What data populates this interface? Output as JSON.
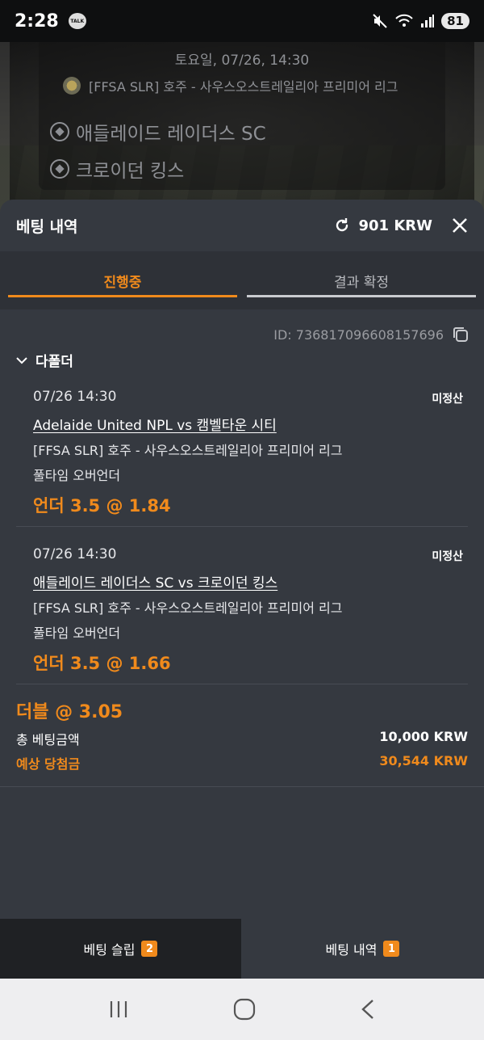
{
  "status_bar": {
    "time": "2:28",
    "talk_label": "TALK",
    "battery": "81"
  },
  "match_header": {
    "date": "토요일, 07/26, 14:30",
    "league": "[FFSA SLR] 호주 - 사우스오스트레일리아 프리미어 리그",
    "team_home": "애들레이드 레이더스 SC",
    "team_away": "크로이던 킹스"
  },
  "sheet": {
    "title": "베팅 내역",
    "balance": "901 KRW",
    "tabs": [
      {
        "label": "진행중",
        "active": true
      },
      {
        "label": "결과 확정",
        "active": false
      }
    ],
    "bet_id": "ID: 736817096608157696",
    "folder_type": "다폴더",
    "bets": [
      {
        "datetime": "07/26 14:30",
        "status": "미정산",
        "match": "Adelaide United NPL vs 캠벨타운 시티",
        "league": "[FFSA SLR] 호주 - 사우스오스트레일리아 프리미어 리그",
        "market": "풀타임 오버언더",
        "pick": "언더 3.5 @ 1.84"
      },
      {
        "datetime": "07/26 14:30",
        "status": "미정산",
        "match": "애들레이드 레이더스 SC vs 크로이던 킹스",
        "league": "[FFSA SLR] 호주 - 사우스오스트레일리아 프리미어 리그",
        "market": "풀타임 오버언더",
        "pick": "언더 3.5 @ 1.66"
      }
    ],
    "summary": {
      "type": "더블 @ 3.05",
      "total_label": "총 베팅금액",
      "total_value": "10,000 KRW",
      "win_label": "예상 당첨금",
      "win_value": "30,544 KRW"
    }
  },
  "bottom_tabs": [
    {
      "label": "베팅 슬립",
      "badge": "2"
    },
    {
      "label": "베팅 내역",
      "badge": "1"
    }
  ],
  "colors": {
    "accent": "#f08a1c",
    "sheet_bg": "#353940",
    "tab_bg": "#2e3137"
  }
}
